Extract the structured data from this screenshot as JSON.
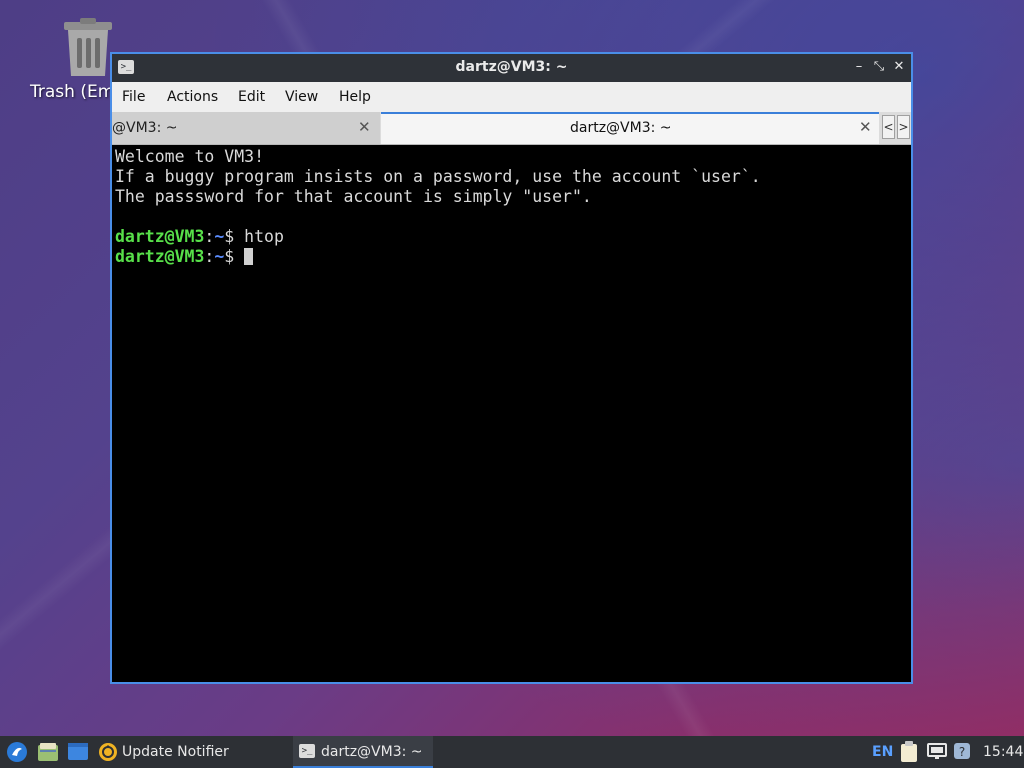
{
  "desktop": {
    "icons": [
      {
        "label": "Trash (Em",
        "icon": "trash-icon"
      }
    ]
  },
  "window": {
    "title": "dartz@VM3: ~",
    "app_icon_glyph": ">_",
    "controls": {
      "minimize": "–",
      "maximize": "⤡",
      "close": "✕"
    },
    "menu": [
      "File",
      "Actions",
      "Edit",
      "View",
      "Help"
    ],
    "tabs": [
      {
        "label": "@VM3: ~",
        "active": false,
        "close": "✕"
      },
      {
        "label": "dartz@VM3: ~",
        "active": true,
        "close": "✕"
      }
    ],
    "tab_scroll": {
      "left": "<",
      "right": ">"
    }
  },
  "terminal": {
    "lines": [
      "Welcome to VM3!",
      "If a buggy program insists on a password, use the account `user`.",
      "The passsword for that account is simply \"user\".",
      ""
    ],
    "prompts": [
      {
        "user": "dartz@VM3",
        "sep": ":",
        "path": "~",
        "symbol": "$ ",
        "command": "htop"
      },
      {
        "user": "dartz@VM3",
        "sep": ":",
        "path": "~",
        "symbol": "$ ",
        "command": ""
      }
    ]
  },
  "taskbar": {
    "start_icon": "lxqt-start-icon",
    "quicklaunch": [
      "file-manager-icon",
      "show-desktop-icon"
    ],
    "tasks": [
      {
        "label": "Update Notifier",
        "icon": "update-notifier-icon"
      },
      {
        "label": "dartz@VM3: ~",
        "icon": "terminal-icon",
        "active": true
      }
    ],
    "tray": {
      "keyboard_layout": "EN",
      "icons": [
        "clipboard-icon",
        "network-icon",
        "notification-icon"
      ],
      "clock": "15:44"
    }
  },
  "colors": {
    "accent": "#3a7fd9",
    "prompt_user": "#58e04a",
    "prompt_path": "#5a8cff",
    "terminal_bg": "#000000",
    "terminal_fg": "#d9d9d9"
  }
}
